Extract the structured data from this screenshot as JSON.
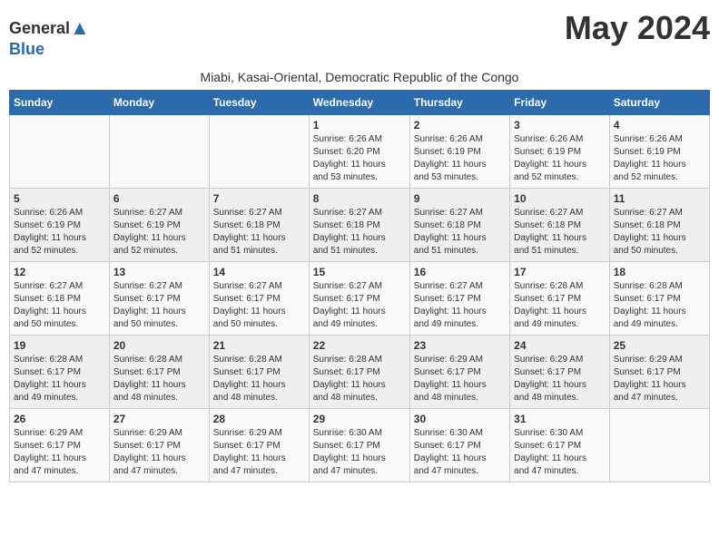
{
  "header": {
    "logo_general": "General",
    "logo_blue": "Blue",
    "month_title": "May 2024",
    "location": "Miabi, Kasai-Oriental, Democratic Republic of the Congo"
  },
  "weekdays": [
    "Sunday",
    "Monday",
    "Tuesday",
    "Wednesday",
    "Thursday",
    "Friday",
    "Saturday"
  ],
  "weeks": [
    [
      {
        "day": "",
        "info": ""
      },
      {
        "day": "",
        "info": ""
      },
      {
        "day": "",
        "info": ""
      },
      {
        "day": "1",
        "info": "Sunrise: 6:26 AM\nSunset: 6:20 PM\nDaylight: 11 hours\nand 53 minutes."
      },
      {
        "day": "2",
        "info": "Sunrise: 6:26 AM\nSunset: 6:19 PM\nDaylight: 11 hours\nand 53 minutes."
      },
      {
        "day": "3",
        "info": "Sunrise: 6:26 AM\nSunset: 6:19 PM\nDaylight: 11 hours\nand 52 minutes."
      },
      {
        "day": "4",
        "info": "Sunrise: 6:26 AM\nSunset: 6:19 PM\nDaylight: 11 hours\nand 52 minutes."
      }
    ],
    [
      {
        "day": "5",
        "info": "Sunrise: 6:26 AM\nSunset: 6:19 PM\nDaylight: 11 hours\nand 52 minutes."
      },
      {
        "day": "6",
        "info": "Sunrise: 6:27 AM\nSunset: 6:19 PM\nDaylight: 11 hours\nand 52 minutes."
      },
      {
        "day": "7",
        "info": "Sunrise: 6:27 AM\nSunset: 6:18 PM\nDaylight: 11 hours\nand 51 minutes."
      },
      {
        "day": "8",
        "info": "Sunrise: 6:27 AM\nSunset: 6:18 PM\nDaylight: 11 hours\nand 51 minutes."
      },
      {
        "day": "9",
        "info": "Sunrise: 6:27 AM\nSunset: 6:18 PM\nDaylight: 11 hours\nand 51 minutes."
      },
      {
        "day": "10",
        "info": "Sunrise: 6:27 AM\nSunset: 6:18 PM\nDaylight: 11 hours\nand 51 minutes."
      },
      {
        "day": "11",
        "info": "Sunrise: 6:27 AM\nSunset: 6:18 PM\nDaylight: 11 hours\nand 50 minutes."
      }
    ],
    [
      {
        "day": "12",
        "info": "Sunrise: 6:27 AM\nSunset: 6:18 PM\nDaylight: 11 hours\nand 50 minutes."
      },
      {
        "day": "13",
        "info": "Sunrise: 6:27 AM\nSunset: 6:17 PM\nDaylight: 11 hours\nand 50 minutes."
      },
      {
        "day": "14",
        "info": "Sunrise: 6:27 AM\nSunset: 6:17 PM\nDaylight: 11 hours\nand 50 minutes."
      },
      {
        "day": "15",
        "info": "Sunrise: 6:27 AM\nSunset: 6:17 PM\nDaylight: 11 hours\nand 49 minutes."
      },
      {
        "day": "16",
        "info": "Sunrise: 6:27 AM\nSunset: 6:17 PM\nDaylight: 11 hours\nand 49 minutes."
      },
      {
        "day": "17",
        "info": "Sunrise: 6:28 AM\nSunset: 6:17 PM\nDaylight: 11 hours\nand 49 minutes."
      },
      {
        "day": "18",
        "info": "Sunrise: 6:28 AM\nSunset: 6:17 PM\nDaylight: 11 hours\nand 49 minutes."
      }
    ],
    [
      {
        "day": "19",
        "info": "Sunrise: 6:28 AM\nSunset: 6:17 PM\nDaylight: 11 hours\nand 49 minutes."
      },
      {
        "day": "20",
        "info": "Sunrise: 6:28 AM\nSunset: 6:17 PM\nDaylight: 11 hours\nand 48 minutes."
      },
      {
        "day": "21",
        "info": "Sunrise: 6:28 AM\nSunset: 6:17 PM\nDaylight: 11 hours\nand 48 minutes."
      },
      {
        "day": "22",
        "info": "Sunrise: 6:28 AM\nSunset: 6:17 PM\nDaylight: 11 hours\nand 48 minutes."
      },
      {
        "day": "23",
        "info": "Sunrise: 6:29 AM\nSunset: 6:17 PM\nDaylight: 11 hours\nand 48 minutes."
      },
      {
        "day": "24",
        "info": "Sunrise: 6:29 AM\nSunset: 6:17 PM\nDaylight: 11 hours\nand 48 minutes."
      },
      {
        "day": "25",
        "info": "Sunrise: 6:29 AM\nSunset: 6:17 PM\nDaylight: 11 hours\nand 47 minutes."
      }
    ],
    [
      {
        "day": "26",
        "info": "Sunrise: 6:29 AM\nSunset: 6:17 PM\nDaylight: 11 hours\nand 47 minutes."
      },
      {
        "day": "27",
        "info": "Sunrise: 6:29 AM\nSunset: 6:17 PM\nDaylight: 11 hours\nand 47 minutes."
      },
      {
        "day": "28",
        "info": "Sunrise: 6:29 AM\nSunset: 6:17 PM\nDaylight: 11 hours\nand 47 minutes."
      },
      {
        "day": "29",
        "info": "Sunrise: 6:30 AM\nSunset: 6:17 PM\nDaylight: 11 hours\nand 47 minutes."
      },
      {
        "day": "30",
        "info": "Sunrise: 6:30 AM\nSunset: 6:17 PM\nDaylight: 11 hours\nand 47 minutes."
      },
      {
        "day": "31",
        "info": "Sunrise: 6:30 AM\nSunset: 6:17 PM\nDaylight: 11 hours\nand 47 minutes."
      },
      {
        "day": "",
        "info": ""
      }
    ]
  ]
}
